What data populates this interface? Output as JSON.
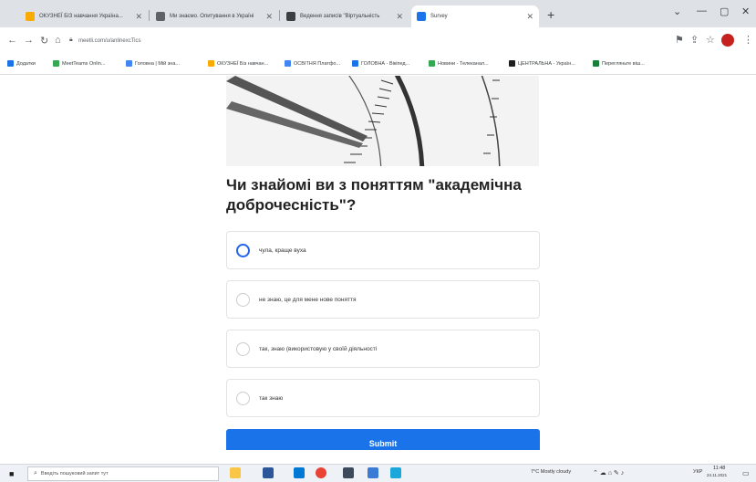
{
  "browser": {
    "tabs": [
      {
        "title": "ОКУЗНЕЇ БІЗ навчання Україна...",
        "fav": "#f9ab00",
        "active": false
      },
      {
        "title": "Ми знаємо. Опитування в Україні",
        "fav": "#5f6368",
        "active": false
      },
      {
        "title": "Ведення записів \"Віртуальність",
        "fav": "#3c4043",
        "active": false
      },
      {
        "title": "Survey",
        "fav": "#1a73e8",
        "active": true
      }
    ],
    "new_tab": "+",
    "controls": {
      "minimize": "—",
      "maximize": "▢",
      "close": "✕",
      "dropdown": "⌄"
    },
    "url": "meetli.com/u/anlinexcTics"
  },
  "bookmarks": [
    {
      "label": "Додатки",
      "fav": "#1a73e8"
    },
    {
      "label": "MeetTeams Onlin...",
      "fav": "#34a853"
    },
    {
      "label": "Головна | Мій зна...",
      "fav": "#4285f4"
    },
    {
      "label": "ОКУЗНЕЇ Біз навчан...",
      "fav": "#f9ab00"
    },
    {
      "label": "ОСВІТНЯ Платфо...",
      "fav": "#4285f4"
    },
    {
      "label": "ГОЛОВНА - Вікіпед...",
      "fav": "#1a73e8"
    },
    {
      "label": "Новини - Телеканал...",
      "fav": "#34a853"
    },
    {
      "label": "ЦЕНТРАЛЬНА - Україн...",
      "fav": "#1f1f1f"
    },
    {
      "label": "Перегляньте віш...",
      "fav": "#188038"
    }
  ],
  "survey": {
    "question": "Чи знайомі ви з поняттям \"академічна доброчесність\"?",
    "options": [
      {
        "label": "чула, краще вуха",
        "selected": true
      },
      {
        "label": "не знаю, це для мене нове поняття",
        "selected": false
      },
      {
        "label": "так, знаю (використовую у своїй діяльності",
        "selected": false
      },
      {
        "label": "так знаю",
        "selected": false
      }
    ],
    "submit_label": "Submit"
  },
  "taskbar": {
    "search_placeholder": "Введіть пошуковий запит тут",
    "weather": "7°C  Mostly cloudy",
    "language": "УКР",
    "time": "11:48",
    "date": "24.11.2021"
  },
  "colors": {
    "accent": "#1a73e8",
    "radio_selected": "#2563eb"
  }
}
